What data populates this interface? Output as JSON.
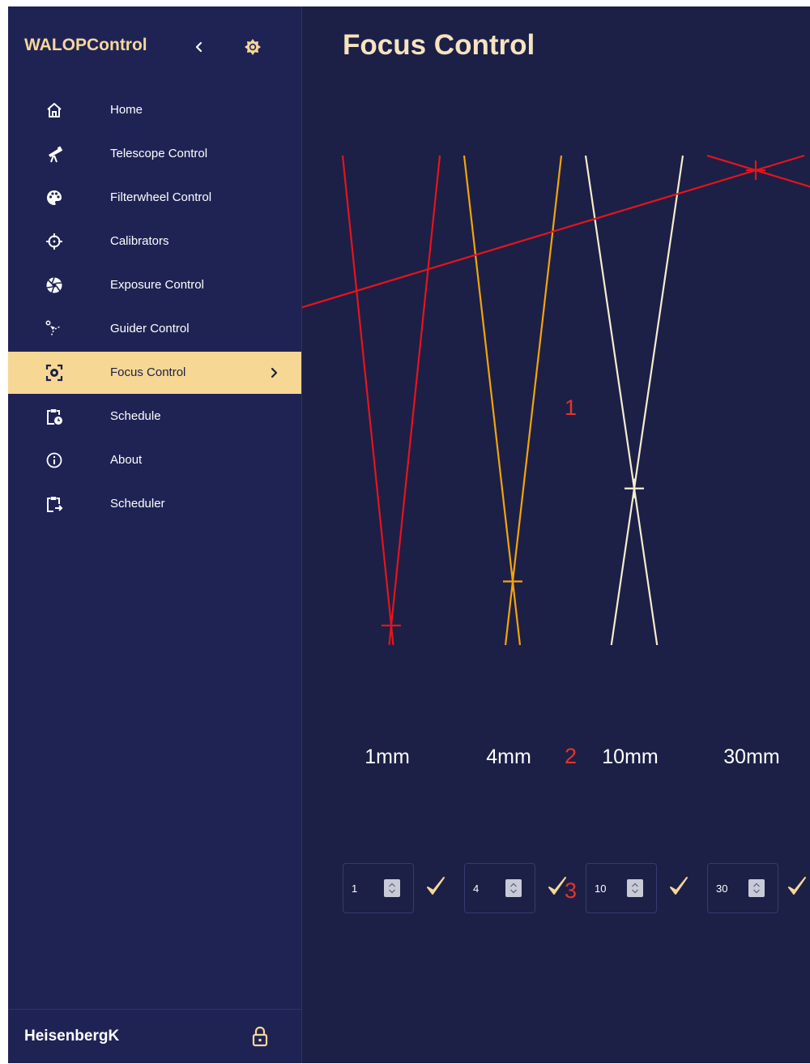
{
  "app": {
    "brand": "WALOPControl",
    "collapse_icon": "chevron-left-icon",
    "theme_icon": "sun-icon",
    "accent_color": "#f7d794",
    "sidebar_color": "#1f2354",
    "background_color": "#1c2046"
  },
  "sidebar": {
    "items": [
      {
        "label": "Home",
        "icon": "home-icon",
        "active": false
      },
      {
        "label": "Telescope Control",
        "icon": "telescope-icon",
        "active": false
      },
      {
        "label": "Filterwheel Control",
        "icon": "palette-icon",
        "active": false
      },
      {
        "label": "Calibrators",
        "icon": "crosshair-icon",
        "active": false
      },
      {
        "label": "Exposure Control",
        "icon": "aperture-icon",
        "active": false
      },
      {
        "label": "Guider Control",
        "icon": "satellite-icon",
        "active": false
      },
      {
        "label": "Focus Control",
        "icon": "focus-icon",
        "active": true
      },
      {
        "label": "Schedule",
        "icon": "clipboard-clock-icon",
        "active": false
      },
      {
        "label": "About",
        "icon": "info-icon",
        "active": false
      },
      {
        "label": "Scheduler",
        "icon": "clipboard-arrow-icon",
        "active": false
      }
    ]
  },
  "user": {
    "name": "HeisenbergK",
    "lock_icon": "lock-icon"
  },
  "main": {
    "title": "Focus Control",
    "markers": [
      "1",
      "2",
      "3"
    ],
    "focus_positions": [
      {
        "size_label": "1mm",
        "value": "1",
        "color": "#e8131a",
        "focus_level": 0.96
      },
      {
        "size_label": "4mm",
        "value": "4",
        "color": "#f5a30c",
        "focus_level": 0.87
      },
      {
        "size_label": "10mm",
        "value": "10",
        "color": "#f8ecd0",
        "focus_level": 0.68
      },
      {
        "size_label": "30mm",
        "value": "30",
        "color": "#e8131a",
        "focus_level": 0.03
      }
    ],
    "confirm_icon": "checkmark-icon"
  }
}
